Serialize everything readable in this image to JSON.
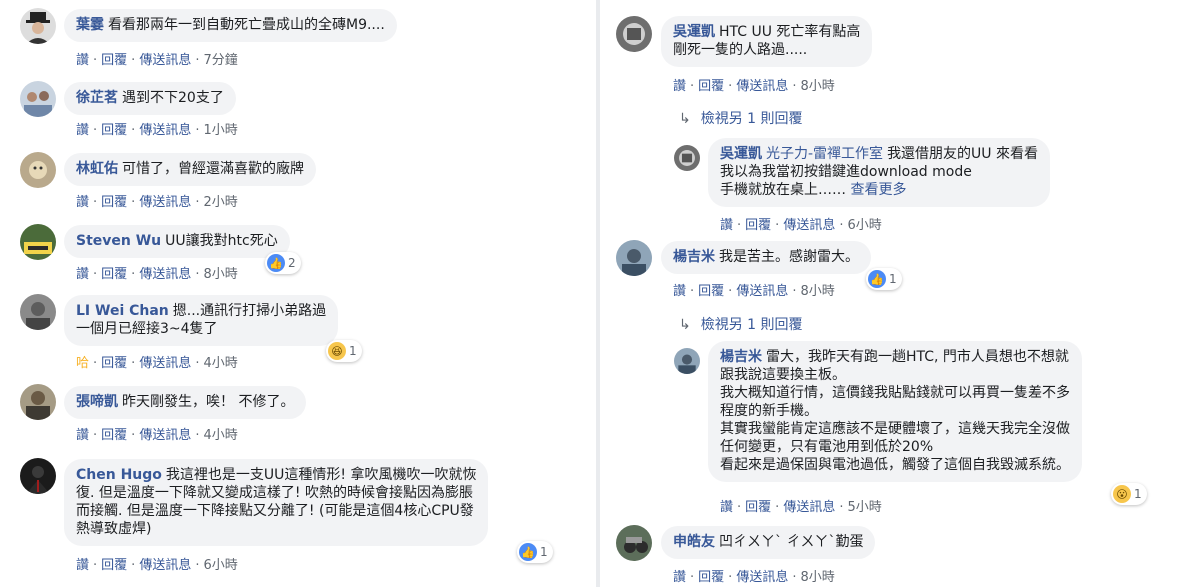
{
  "actions": {
    "like": "讚",
    "reply": "回覆",
    "message": "傳送訊息",
    "haha": "哈"
  },
  "left": [
    {
      "name": "葉霎",
      "text": "看看那兩年一到自動死亡疊成山的全磚M9....",
      "time": "7分鐘"
    },
    {
      "name": "徐芷茗",
      "text": "遇到不下20支了",
      "time": "1小時"
    },
    {
      "name": "林虹佑",
      "text": "可惜了，曾經還滿喜歡的廠牌",
      "time": "2小時"
    },
    {
      "name": "Steven Wu",
      "text": "UU讓我對htc死心",
      "time": "8小時",
      "react_count": "2"
    },
    {
      "name": "LI Wei Chan",
      "text": "摁...通訊行打掃小弟路過",
      "text2": "一個月已經接3~4隻了",
      "time": "4小時",
      "react_count": "1"
    },
    {
      "name": "張啼凱",
      "text": "昨天剛發生，唉！ 不修了。",
      "time": "4小時"
    },
    {
      "name": "Chen Hugo",
      "text": "我這裡也是一支UU這種情形! 拿吹風機吹一吹就恢",
      "text2": "復. 但是溫度一下降就又變成這樣了! 吹熱的時候會接點因為膨脹",
      "text3": "而接觸. 但是溫度一下降接點又分離了! (可能是這個4核心CPU發",
      "text4": "熱導致虛焊)",
      "time": "6小時",
      "react_count": "1"
    }
  ],
  "right": [
    {
      "name": "吳運凱",
      "text": "HTC UU 死亡率有點高",
      "text2": "剛死一隻的人路過.....",
      "time": "8小時"
    },
    {
      "replies_label": "檢視另 1 則回覆"
    },
    {
      "name": "吳運凱",
      "mention": "光子力-雷禪工作室",
      "text": "我還借朋友的UU 來看看",
      "text2": "我以為我當初按錯鍵進download mode",
      "text3": "手機就放在桌上……",
      "more": "查看更多",
      "time": "6小時"
    },
    {
      "name": "楊吉米",
      "text": "我是苦主。感謝雷大。",
      "time": "8小時",
      "react_count": "1"
    },
    {
      "replies_label": "檢視另 1 則回覆"
    },
    {
      "name": "楊吉米",
      "text": "雷大，我昨天有跑一趟HTC, 門市人員想也不想就",
      "text2": "跟我說這要換主板。",
      "text3": "我大概知道行情，這價錢我貼點錢就可以再買一隻差不多",
      "text4": "程度的新手機。",
      "text5": "其實我蠻能肯定這應該不是硬體壞了，這幾天我完全沒做",
      "text6": "任何變更，只有電池用到低於20%",
      "text7": "看起來是過保固與電池過低，觸發了這個自我毀滅系統。",
      "time": "5小時",
      "react_count": "1"
    },
    {
      "name": "申皓友",
      "text": "凹ㄔㄨㄚˋ ㄔㄨㄚˋ勤蛋",
      "time": "8小時"
    }
  ]
}
